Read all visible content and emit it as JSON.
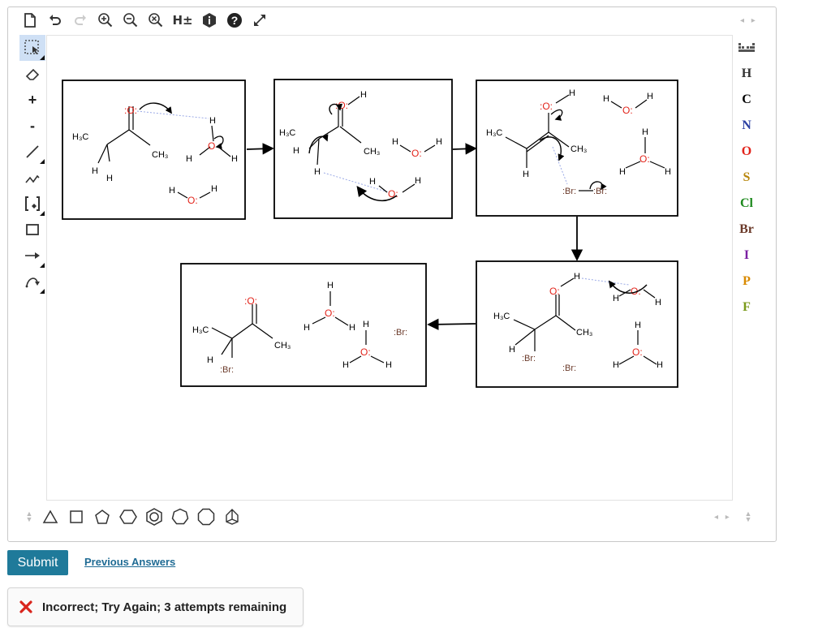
{
  "toolbar": {
    "icons": [
      "new-document-icon",
      "undo-icon",
      "redo-icon",
      "zoom-in-icon",
      "zoom-out-icon",
      "zoom-reset-icon",
      "add-hydrogens-icon",
      "info-icon",
      "help-icon",
      "fullscreen-icon"
    ],
    "h_toggle_label": "H±",
    "scroll_arrows": "◂ ▸"
  },
  "left_tools": {
    "plus_label": "+",
    "minus_label": "-"
  },
  "elements": [
    {
      "symbol": "H",
      "color": "#333333"
    },
    {
      "symbol": "C",
      "color": "#000000"
    },
    {
      "symbol": "N",
      "color": "#2a3fa3"
    },
    {
      "symbol": "O",
      "color": "#e2231a"
    },
    {
      "symbol": "S",
      "color": "#b8860b"
    },
    {
      "symbol": "Cl",
      "color": "#1e8a1e"
    },
    {
      "symbol": "Br",
      "color": "#6b3a2a"
    },
    {
      "symbol": "I",
      "color": "#7a1fa2"
    },
    {
      "symbol": "P",
      "color": "#d98a00"
    },
    {
      "symbol": "F",
      "color": "#7a9a1a"
    }
  ],
  "canvas": {
    "atom_labels": {
      "O": ":O:",
      "O_single": "O:",
      "Br": ":Br:",
      "H": "H",
      "H3C": "H₃C",
      "CH3": "CH₃"
    }
  },
  "actions": {
    "submit_label": "Submit",
    "previous_answers_label": "Previous Answers"
  },
  "feedback": {
    "message": "Incorrect; Try Again; 3 attempts remaining",
    "icon": "red-x-icon"
  },
  "colors": {
    "accent": "#1f7a9a",
    "oxygen": "#e2231a",
    "bromine": "#6b3a2a",
    "error": "#d9251d"
  }
}
